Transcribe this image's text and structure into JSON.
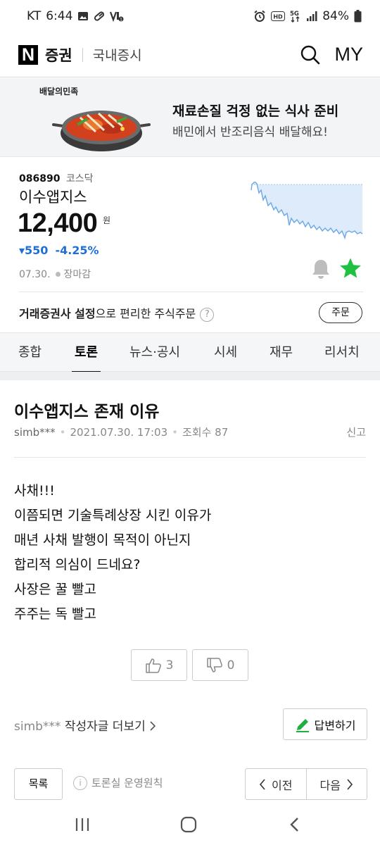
{
  "status_bar": {
    "carrier": "KT",
    "time": "6:44",
    "battery": "84%",
    "icons": [
      "image-icon",
      "pill-icon",
      "volte-icon",
      "alarm-icon",
      "hd-icon",
      "5g-icon",
      "signal-icon",
      "battery-icon"
    ]
  },
  "header": {
    "logo": "N",
    "brand": "증권",
    "section": "국내증시",
    "my_label": "MY",
    "icons": [
      "search-icon"
    ]
  },
  "banner": {
    "brand": "배달의민족",
    "title": "재료손질 걱정 없는 식사 준비",
    "subtitle": "배민에서 반조리음식 배달해요!"
  },
  "stock": {
    "code": "086890",
    "market": "코스닥",
    "name": "이수앱지스",
    "price": "12,400",
    "unit": "원",
    "change": "▾550",
    "change_rate": "-4.25%",
    "date": "07.30.",
    "market_status": "장마감",
    "broker_bold": "거래증권사 설정",
    "broker_rest": "으로 편리한 주식주문",
    "help_mark": "?",
    "order_button": "주문",
    "colors": {
      "down": "#1f6fd6",
      "star": "#20c040",
      "spark_line": "#6aa7e6",
      "spark_fill": "#ddebfa"
    }
  },
  "tabs": [
    {
      "label": "종합",
      "active": false
    },
    {
      "label": "토론",
      "active": true
    },
    {
      "label": "뉴스·공시",
      "active": false
    },
    {
      "label": "시세",
      "active": false
    },
    {
      "label": "재무",
      "active": false
    },
    {
      "label": "리서치",
      "active": false
    }
  ],
  "post": {
    "title": "이수앱지스 존재 이유",
    "author": "simb***",
    "datetime": "2021.07.30. 17:03",
    "views": "조회수 87",
    "report": "신고",
    "lines": [
      "사채!!!",
      "이쯤되면 기술특례상장 시킨 이유가",
      "매년 사채 발행이 목적이 아닌지",
      "합리적 의심이 드네요?",
      "사장은 꿀 빨고",
      "주주는 독 빨고"
    ],
    "likes": "3",
    "dislikes": "0"
  },
  "footer_actions": {
    "more_author": "simb***",
    "more_label": "작성자글 더보기",
    "reply": "답변하기",
    "list": "목록",
    "rules": "토론실 운영원칙",
    "prev": "이전",
    "next": "다음"
  }
}
